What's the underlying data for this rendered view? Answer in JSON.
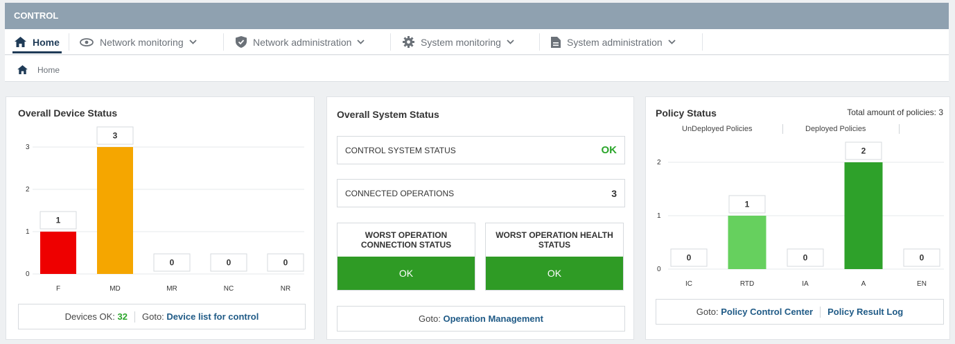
{
  "app": {
    "title": "CONTROL"
  },
  "nav": {
    "items": [
      {
        "label": "Home",
        "icon": "home-icon",
        "active": true
      },
      {
        "label": "Network monitoring",
        "icon": "eye-icon"
      },
      {
        "label": "Network administration",
        "icon": "shield-icon"
      },
      {
        "label": "System monitoring",
        "icon": "gear-icon"
      },
      {
        "label": "System administration",
        "icon": "document-icon"
      }
    ]
  },
  "breadcrumb": {
    "label": "Home"
  },
  "device_status": {
    "title": "Overall Device Status",
    "footer": {
      "ok_label": "Devices OK:",
      "ok_value": "32",
      "goto_label": "Goto:",
      "link": "Device list for control"
    }
  },
  "system_status": {
    "title": "Overall System Status",
    "control_label": "CONTROL SYSTEM STATUS",
    "control_value": "OK",
    "connected_label": "CONNECTED OPERATIONS",
    "connected_value": "3",
    "worst_connection_title": "WORST OPERATION CONNECTION STATUS",
    "worst_connection_value": "OK",
    "worst_health_title": "WORST OPERATION HEALTH STATUS",
    "worst_health_value": "OK",
    "footer": {
      "goto_label": "Goto:",
      "link": "Operation Management"
    }
  },
  "policy_status": {
    "title": "Policy Status",
    "total": "Total amount of policies: 3",
    "legend": [
      "UnDeployed Policies",
      "Deployed Policies"
    ],
    "footer": {
      "goto_label": "Goto:",
      "link1": "Policy Control Center",
      "link2": "Policy Result Log"
    }
  },
  "colors": {
    "header": "#8fa1b0",
    "nav_active": "#1f3b57",
    "ok_green": "#2f9b25",
    "link": "#1f5a86"
  },
  "chart_data": [
    {
      "type": "bar",
      "title": "Overall Device Status",
      "categories": [
        "F",
        "MD",
        "MR",
        "NC",
        "NR"
      ],
      "values": [
        1,
        3,
        0,
        0,
        0
      ],
      "colors": [
        "#ee0000",
        "#f5a600",
        "#cccccc",
        "#cccccc",
        "#cccccc"
      ],
      "yticks": [
        0,
        1,
        2,
        3
      ],
      "ylim": [
        0,
        3
      ],
      "grid": true
    },
    {
      "type": "bar",
      "title": "Policy Status",
      "categories": [
        "IC",
        "RTD",
        "IA",
        "A",
        "EN"
      ],
      "values": [
        0,
        1,
        0,
        2,
        0
      ],
      "colors": [
        "#cccccc",
        "#66d05e",
        "#cccccc",
        "#2ea12a",
        "#cccccc"
      ],
      "yticks": [
        0,
        1,
        2
      ],
      "ylim": [
        0,
        2
      ],
      "grid": true
    }
  ]
}
